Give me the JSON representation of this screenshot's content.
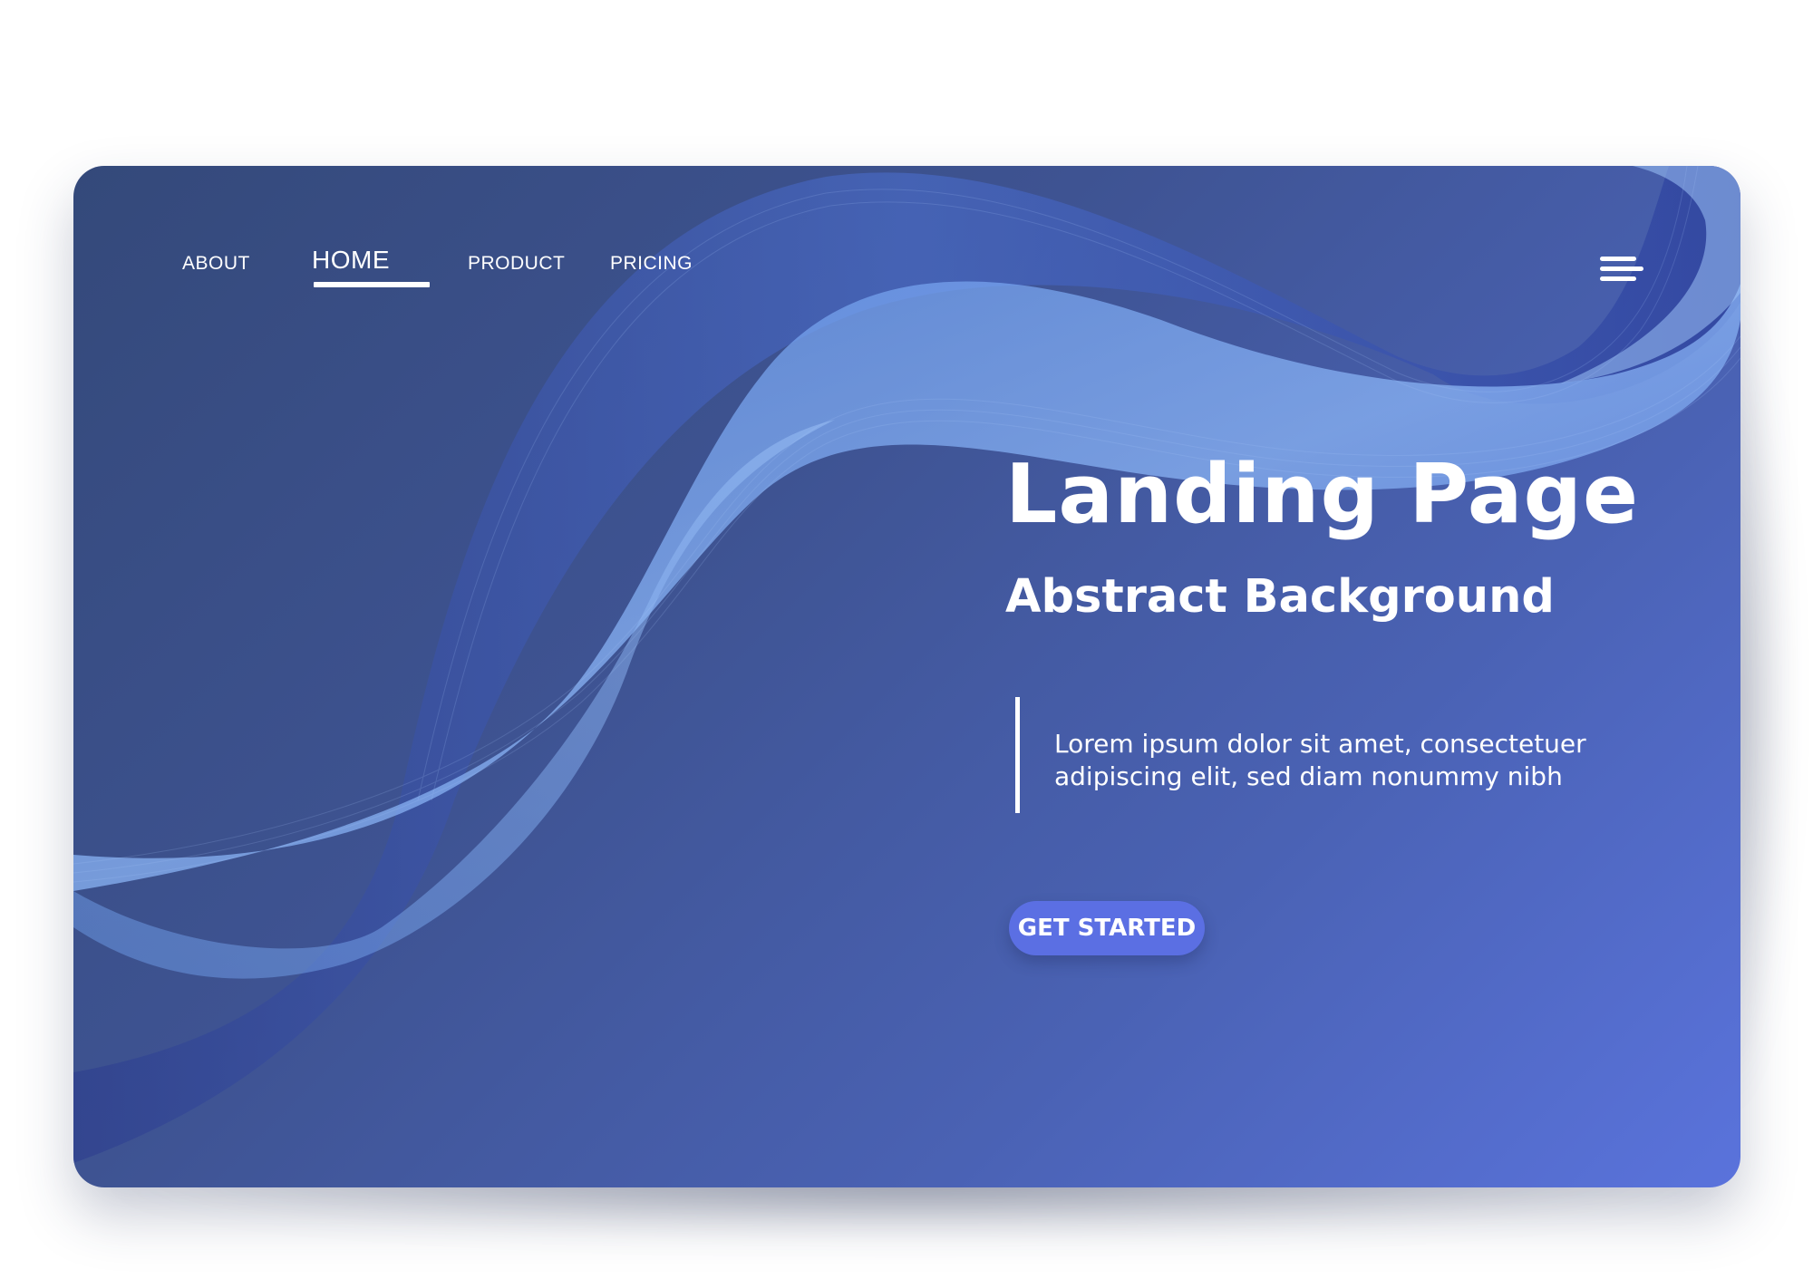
{
  "nav": {
    "items": [
      {
        "label": "ABOUT"
      },
      {
        "label": "HOME",
        "active": true
      },
      {
        "label": "PRODUCT"
      },
      {
        "label": "PRICING"
      }
    ],
    "menu_icon": "hamburger-menu-icon"
  },
  "hero": {
    "title": "Landing Page",
    "subtitle": "Abstract Background",
    "body": "Lorem ipsum dolor sit amet, consectetuer adipiscing elit, sed diam nonummy nibh",
    "cta_label": "GET STARTED"
  },
  "colors": {
    "card_dark": "#34497a",
    "card_light": "#5a73dc",
    "wave_light": "#7aa7f0",
    "cta_background": "#5b6fe3",
    "text": "#ffffff"
  }
}
